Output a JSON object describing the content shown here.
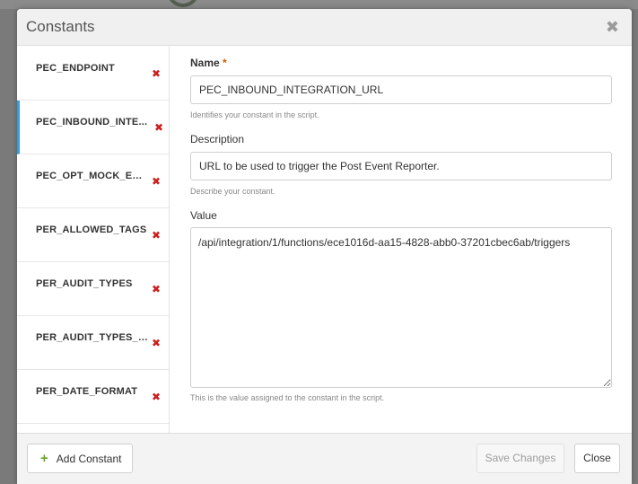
{
  "dialog": {
    "title": "Constants",
    "close_symbol": "✖"
  },
  "sidebar": {
    "items": [
      {
        "label": "PEC_ENDPOINT",
        "delete_symbol": "✖"
      },
      {
        "label": "PEC_INBOUND_INTE...",
        "delete_symbol": "✖",
        "active": true
      },
      {
        "label": "PEC_OPT_MOCK_EN...",
        "delete_symbol": "✖"
      },
      {
        "label": "PER_ALLOWED_TAGS",
        "delete_symbol": "✖"
      },
      {
        "label": "PER_AUDIT_TYPES",
        "delete_symbol": "✖"
      },
      {
        "label": "PER_AUDIT_TYPES_A...",
        "delete_symbol": "✖"
      },
      {
        "label": "PER_DATE_FORMAT",
        "delete_symbol": "✖"
      }
    ]
  },
  "form": {
    "name": {
      "label": "Name",
      "required_mark": "*",
      "value": "PEC_INBOUND_INTEGRATION_URL",
      "help": "Identifies your constant in the script."
    },
    "description": {
      "label": "Description",
      "value": "URL to be used to trigger the Post Event Reporter.",
      "help": "Describe your constant."
    },
    "value": {
      "label": "Value",
      "value": "/api/integration/1/functions/ece1016d-aa15-4828-abb0-37201cbec6ab/triggers",
      "help": "This is the value assigned to the constant in the script."
    }
  },
  "footer": {
    "add_icon": "+",
    "add_label": "Add Constant",
    "save_label": "Save Changes",
    "close_label": "Close"
  },
  "colors": {
    "accent": "#3a9bd5",
    "delete": "#cc1f1f",
    "add": "#6ba42a",
    "required": "#d15b00"
  }
}
